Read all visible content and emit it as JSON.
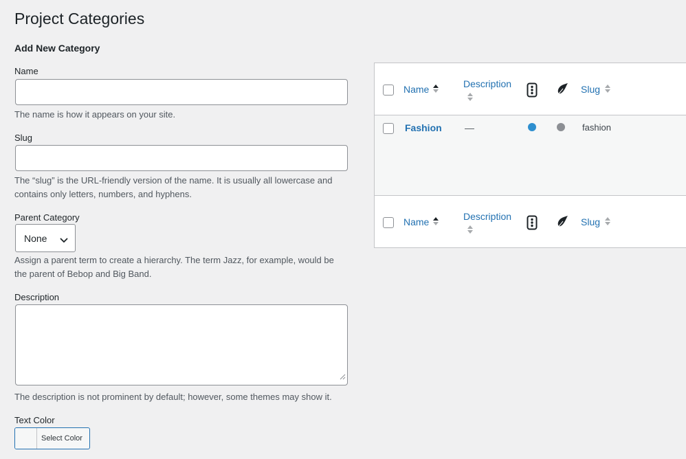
{
  "page": {
    "title": "Project Categories"
  },
  "form": {
    "section_title": "Add New Category",
    "name": {
      "label": "Name",
      "value": "",
      "placeholder": "",
      "help": "The name is how it appears on your site."
    },
    "slug": {
      "label": "Slug",
      "value": "",
      "placeholder": "",
      "help": "The “slug” is the URL-friendly version of the name. It is usually all lowercase and contains only letters, numbers, and hyphens."
    },
    "parent": {
      "label": "Parent Category",
      "selected": "None",
      "help": "Assign a parent term to create a hierarchy. The term Jazz, for example, would be the parent of Bebop and Big Band."
    },
    "description": {
      "label": "Description",
      "value": "",
      "help": "The description is not prominent by default; however, some themes may show it."
    },
    "text_color": {
      "label": "Text Color",
      "button_label": "Select Color"
    }
  },
  "table": {
    "columns": {
      "name": "Name",
      "description": "Description",
      "col3_icon": "traffic-light-icon",
      "col4_icon": "feather-icon",
      "slug": "Slug"
    },
    "rows": [
      {
        "name": "Fashion",
        "description": "—",
        "dot1_color": "#2e8fcf",
        "dot2_color": "#8c8f94",
        "slug": "fashion"
      }
    ]
  },
  "colors": {
    "accent": "#2271b1",
    "border": "#c3c4c7"
  }
}
